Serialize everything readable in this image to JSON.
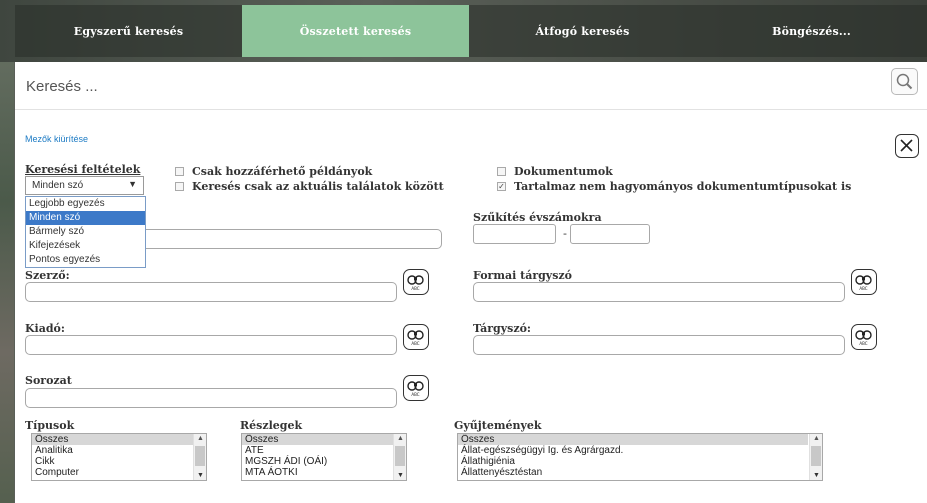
{
  "tabs": [
    {
      "label": "Egyszerű keresés"
    },
    {
      "label": "Összetett keresés"
    },
    {
      "label": "Átfogó keresés"
    },
    {
      "label": "Böngészés..."
    }
  ],
  "search": {
    "placeholder": "Keresés ..."
  },
  "clear_fields": "Mezők kiürítése",
  "conditions": {
    "label": "Keresési feltételek",
    "selected": "Minden szó",
    "options": [
      "Legjobb egyezés",
      "Minden szó",
      "Bármely szó",
      "Kifejezések",
      "Pontos egyezés"
    ]
  },
  "checkboxes": {
    "available_only": {
      "label": "Csak hozzáférhető példányok",
      "checked": false
    },
    "within_results": {
      "label": "Keresés csak az aktuális találatok között",
      "checked": false
    },
    "documents": {
      "label": "Dokumentumok",
      "checked": false
    },
    "nontraditional": {
      "label": "Tartalmaz nem hagyományos dokumentumtípusokat is",
      "checked": true
    }
  },
  "fields": {
    "year_range": {
      "label": "Szűkítés évszámokra",
      "separator": "-"
    },
    "author": {
      "label": "Szerző:"
    },
    "formal_subject": {
      "label": "Formai tárgyszó"
    },
    "publisher": {
      "label": "Kiadó:"
    },
    "subject": {
      "label": "Tárgyszó:"
    },
    "series": {
      "label": "Sorozat"
    }
  },
  "lists": {
    "types": {
      "label": "Típusok",
      "items": [
        "Összes",
        "Analitika",
        "Cikk",
        "Computer"
      ]
    },
    "departments": {
      "label": "Részlegek",
      "items": [
        "Összes",
        "ATE",
        "MGSZH ÁDI (OÁI)",
        "MTA ÁOTKI"
      ]
    },
    "collections": {
      "label": "Gyűjtemények",
      "items": [
        "Összes",
        "Állat-egészségügyi Ig. és Agrárgazd.",
        "Állathigiénia",
        "Állattenyésztéstan"
      ]
    }
  },
  "colors": {
    "active_tab": "#8dc49a",
    "link": "#1d7bc4",
    "dropdown_selected": "#3c79c8"
  }
}
